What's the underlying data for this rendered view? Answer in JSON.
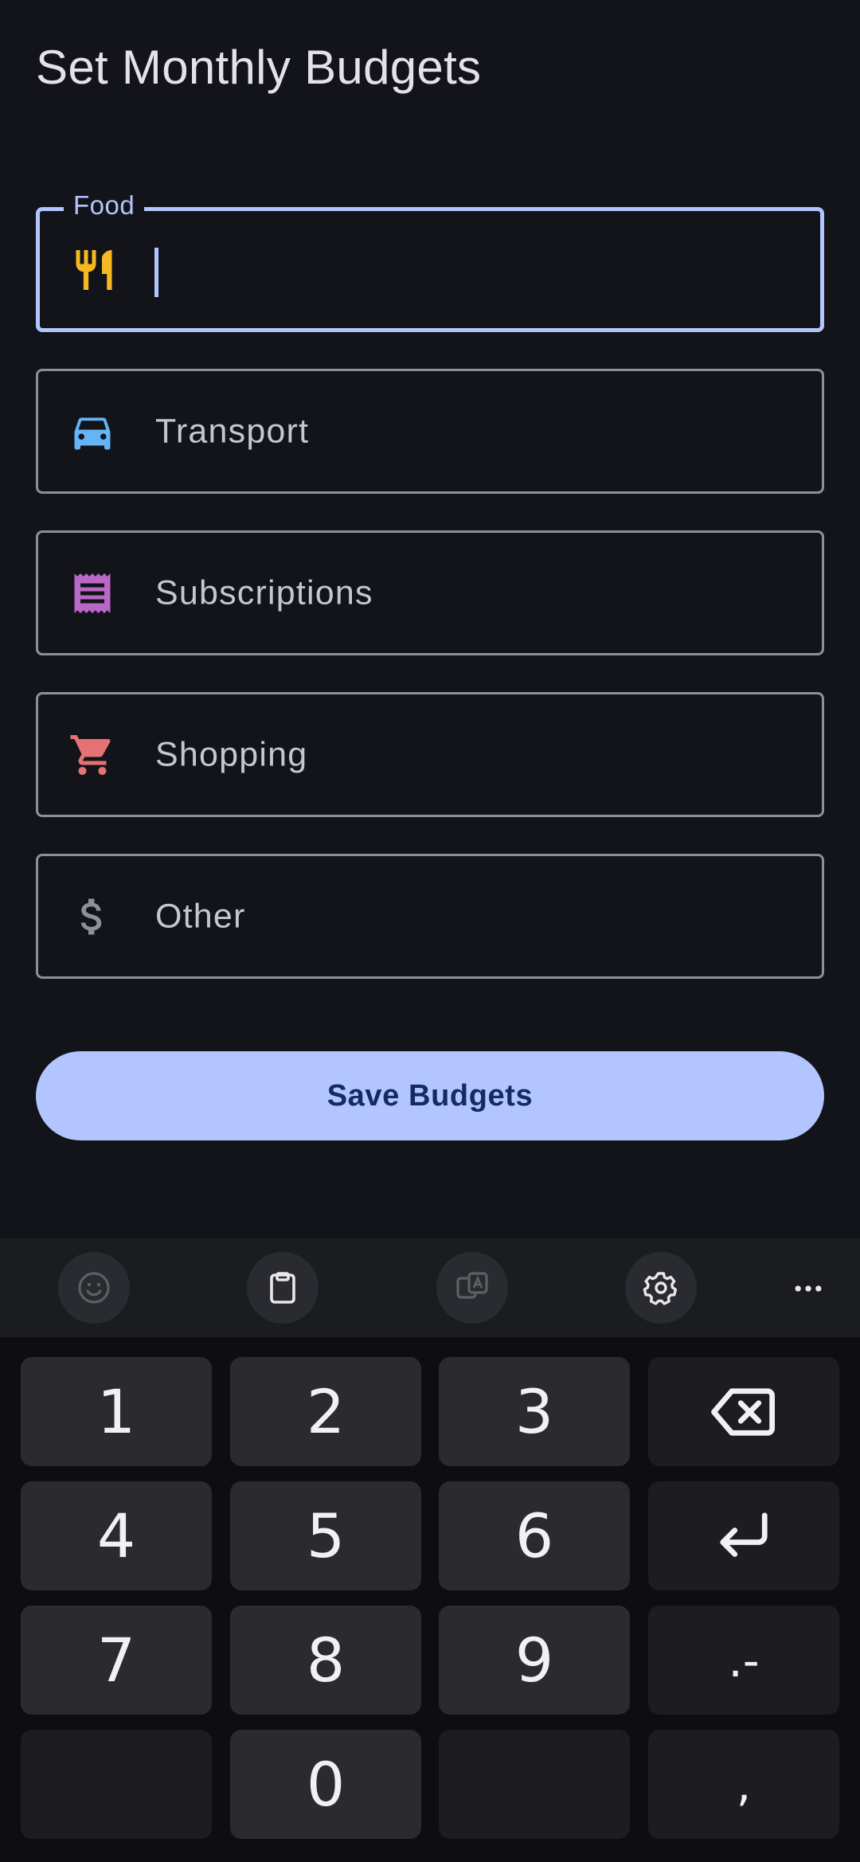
{
  "screen": {
    "title": "Set Monthly Budgets"
  },
  "fields": {
    "food": {
      "label": "Food",
      "value": "",
      "icon": "restaurant-icon",
      "color": "#f5b820"
    },
    "transport": {
      "placeholder": "Transport",
      "icon": "car-icon",
      "color": "#64b5f6"
    },
    "subscriptions": {
      "placeholder": "Subscriptions",
      "icon": "receipt-icon",
      "color": "#ba68c8"
    },
    "shopping": {
      "placeholder": "Shopping",
      "icon": "cart-icon",
      "color": "#e57373"
    },
    "other": {
      "placeholder": "Other",
      "icon": "dollar-icon",
      "color": "#8e9099"
    }
  },
  "actions": {
    "save_label": "Save Budgets"
  },
  "keyboard": {
    "toolbar": [
      "emoji-icon",
      "clipboard-icon",
      "translate-icon",
      "gear-icon",
      "more-icon"
    ],
    "keys": {
      "k1": "1",
      "k2": "2",
      "k3": "3",
      "k4": "4",
      "k5": "5",
      "k6": "6",
      "k7": "7",
      "k8": "8",
      "k9": "9",
      "k0": "0",
      "dot_minus": ".-",
      "comma": ","
    }
  },
  "colors": {
    "background": "#131419",
    "accent": "#b3c5ff",
    "button_text": "#152a5e"
  }
}
